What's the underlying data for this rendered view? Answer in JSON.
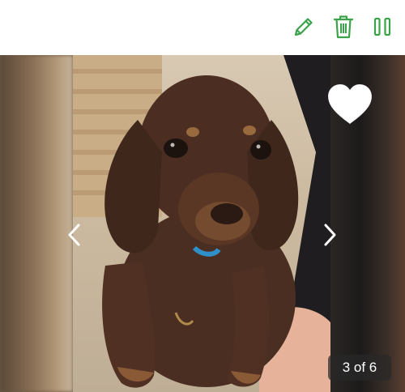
{
  "toolbar": {
    "icons": [
      "pencil-icon",
      "trash-icon",
      "pause-icon"
    ],
    "accent_color": "#3aa34a"
  },
  "gallery": {
    "counter_text": "3 of 6",
    "current_index": 3,
    "total": 6,
    "favorite_icon": "heart-icon",
    "prev_icon": "chevron-left-icon",
    "next_icon": "chevron-right-icon"
  }
}
